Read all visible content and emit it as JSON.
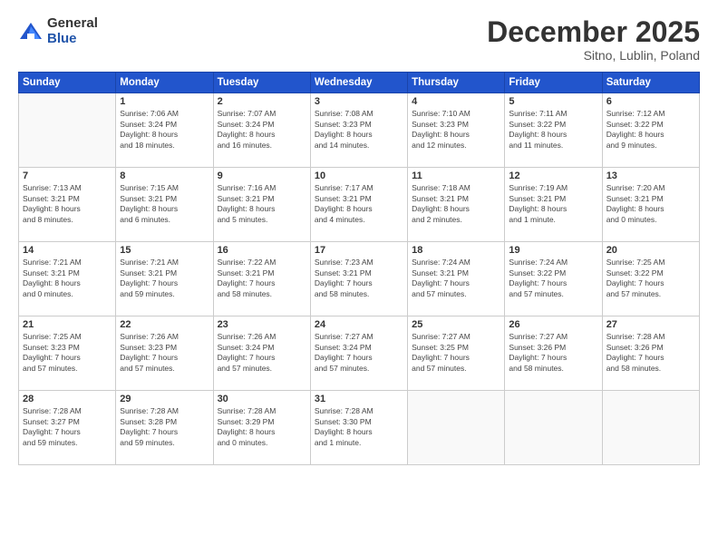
{
  "logo": {
    "general": "General",
    "blue": "Blue"
  },
  "header": {
    "month": "December 2025",
    "location": "Sitno, Lublin, Poland"
  },
  "weekdays": [
    "Sunday",
    "Monday",
    "Tuesday",
    "Wednesday",
    "Thursday",
    "Friday",
    "Saturday"
  ],
  "weeks": [
    [
      {
        "day": "",
        "info": ""
      },
      {
        "day": "1",
        "info": "Sunrise: 7:06 AM\nSunset: 3:24 PM\nDaylight: 8 hours\nand 18 minutes."
      },
      {
        "day": "2",
        "info": "Sunrise: 7:07 AM\nSunset: 3:24 PM\nDaylight: 8 hours\nand 16 minutes."
      },
      {
        "day": "3",
        "info": "Sunrise: 7:08 AM\nSunset: 3:23 PM\nDaylight: 8 hours\nand 14 minutes."
      },
      {
        "day": "4",
        "info": "Sunrise: 7:10 AM\nSunset: 3:23 PM\nDaylight: 8 hours\nand 12 minutes."
      },
      {
        "day": "5",
        "info": "Sunrise: 7:11 AM\nSunset: 3:22 PM\nDaylight: 8 hours\nand 11 minutes."
      },
      {
        "day": "6",
        "info": "Sunrise: 7:12 AM\nSunset: 3:22 PM\nDaylight: 8 hours\nand 9 minutes."
      }
    ],
    [
      {
        "day": "7",
        "info": "Sunrise: 7:13 AM\nSunset: 3:21 PM\nDaylight: 8 hours\nand 8 minutes."
      },
      {
        "day": "8",
        "info": "Sunrise: 7:15 AM\nSunset: 3:21 PM\nDaylight: 8 hours\nand 6 minutes."
      },
      {
        "day": "9",
        "info": "Sunrise: 7:16 AM\nSunset: 3:21 PM\nDaylight: 8 hours\nand 5 minutes."
      },
      {
        "day": "10",
        "info": "Sunrise: 7:17 AM\nSunset: 3:21 PM\nDaylight: 8 hours\nand 4 minutes."
      },
      {
        "day": "11",
        "info": "Sunrise: 7:18 AM\nSunset: 3:21 PM\nDaylight: 8 hours\nand 2 minutes."
      },
      {
        "day": "12",
        "info": "Sunrise: 7:19 AM\nSunset: 3:21 PM\nDaylight: 8 hours\nand 1 minute."
      },
      {
        "day": "13",
        "info": "Sunrise: 7:20 AM\nSunset: 3:21 PM\nDaylight: 8 hours\nand 0 minutes."
      }
    ],
    [
      {
        "day": "14",
        "info": "Sunrise: 7:21 AM\nSunset: 3:21 PM\nDaylight: 8 hours\nand 0 minutes."
      },
      {
        "day": "15",
        "info": "Sunrise: 7:21 AM\nSunset: 3:21 PM\nDaylight: 7 hours\nand 59 minutes."
      },
      {
        "day": "16",
        "info": "Sunrise: 7:22 AM\nSunset: 3:21 PM\nDaylight: 7 hours\nand 58 minutes."
      },
      {
        "day": "17",
        "info": "Sunrise: 7:23 AM\nSunset: 3:21 PM\nDaylight: 7 hours\nand 58 minutes."
      },
      {
        "day": "18",
        "info": "Sunrise: 7:24 AM\nSunset: 3:21 PM\nDaylight: 7 hours\nand 57 minutes."
      },
      {
        "day": "19",
        "info": "Sunrise: 7:24 AM\nSunset: 3:22 PM\nDaylight: 7 hours\nand 57 minutes."
      },
      {
        "day": "20",
        "info": "Sunrise: 7:25 AM\nSunset: 3:22 PM\nDaylight: 7 hours\nand 57 minutes."
      }
    ],
    [
      {
        "day": "21",
        "info": "Sunrise: 7:25 AM\nSunset: 3:23 PM\nDaylight: 7 hours\nand 57 minutes."
      },
      {
        "day": "22",
        "info": "Sunrise: 7:26 AM\nSunset: 3:23 PM\nDaylight: 7 hours\nand 57 minutes."
      },
      {
        "day": "23",
        "info": "Sunrise: 7:26 AM\nSunset: 3:24 PM\nDaylight: 7 hours\nand 57 minutes."
      },
      {
        "day": "24",
        "info": "Sunrise: 7:27 AM\nSunset: 3:24 PM\nDaylight: 7 hours\nand 57 minutes."
      },
      {
        "day": "25",
        "info": "Sunrise: 7:27 AM\nSunset: 3:25 PM\nDaylight: 7 hours\nand 57 minutes."
      },
      {
        "day": "26",
        "info": "Sunrise: 7:27 AM\nSunset: 3:26 PM\nDaylight: 7 hours\nand 58 minutes."
      },
      {
        "day": "27",
        "info": "Sunrise: 7:28 AM\nSunset: 3:26 PM\nDaylight: 7 hours\nand 58 minutes."
      }
    ],
    [
      {
        "day": "28",
        "info": "Sunrise: 7:28 AM\nSunset: 3:27 PM\nDaylight: 7 hours\nand 59 minutes."
      },
      {
        "day": "29",
        "info": "Sunrise: 7:28 AM\nSunset: 3:28 PM\nDaylight: 7 hours\nand 59 minutes."
      },
      {
        "day": "30",
        "info": "Sunrise: 7:28 AM\nSunset: 3:29 PM\nDaylight: 8 hours\nand 0 minutes."
      },
      {
        "day": "31",
        "info": "Sunrise: 7:28 AM\nSunset: 3:30 PM\nDaylight: 8 hours\nand 1 minute."
      },
      {
        "day": "",
        "info": ""
      },
      {
        "day": "",
        "info": ""
      },
      {
        "day": "",
        "info": ""
      }
    ]
  ]
}
